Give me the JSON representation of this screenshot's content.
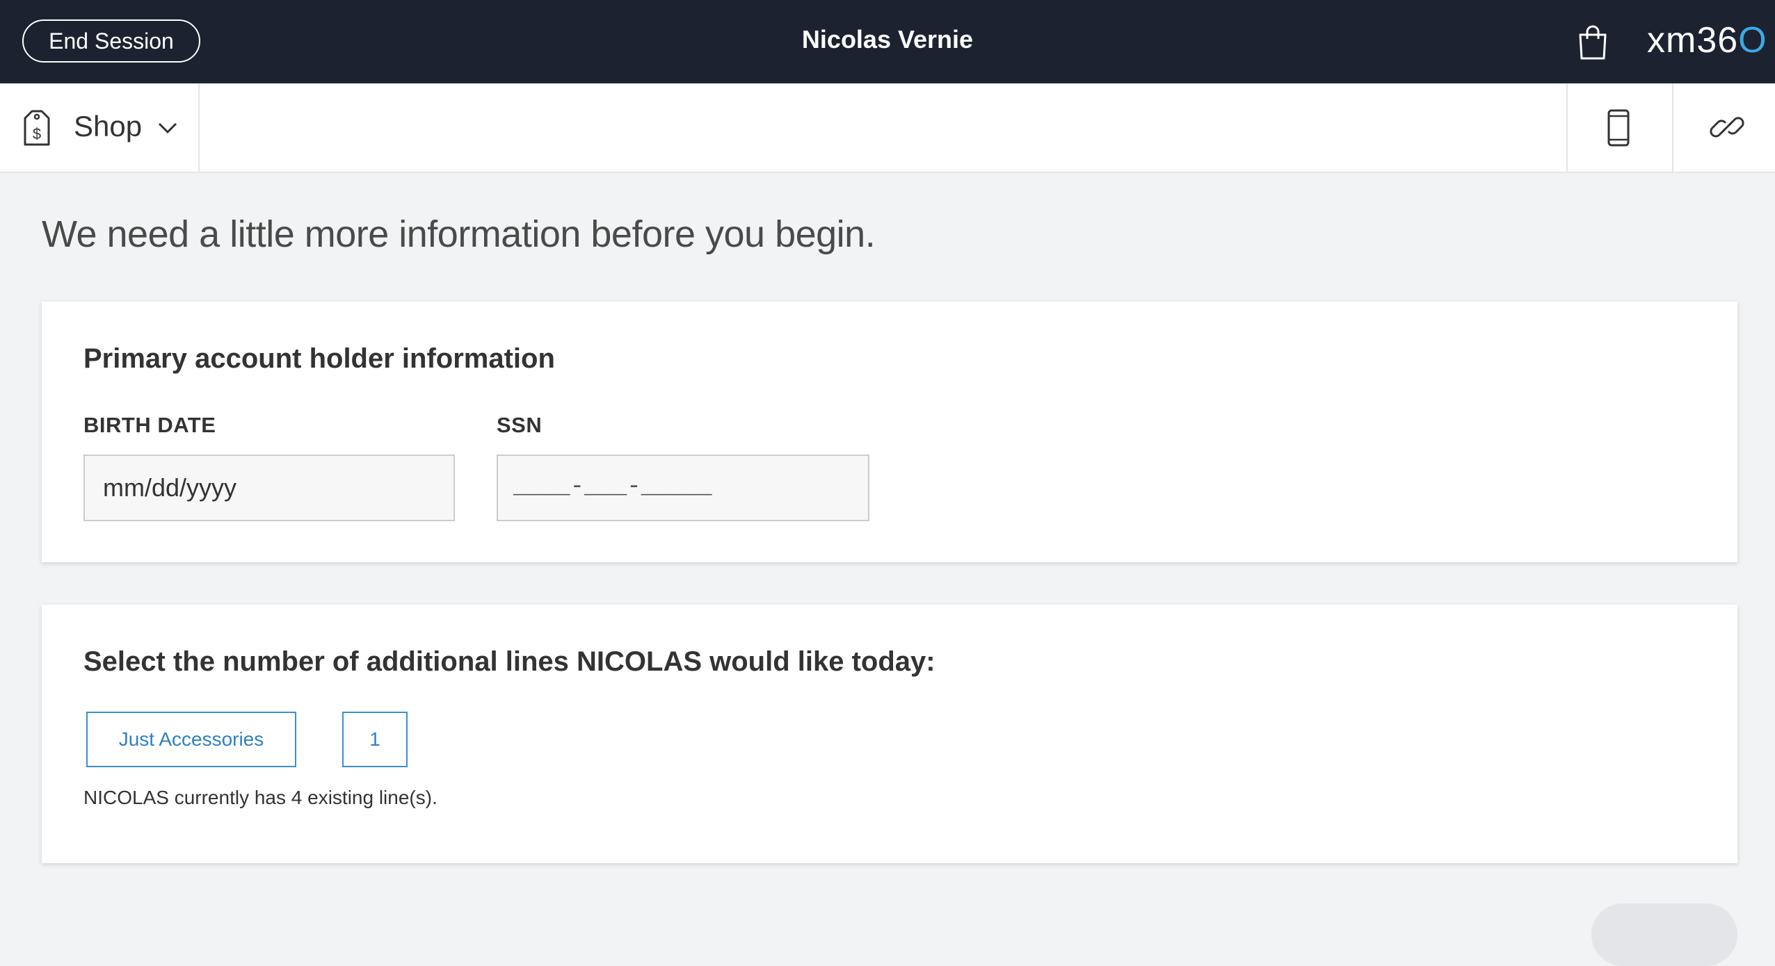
{
  "header": {
    "end_session_label": "End Session",
    "user_name": "Nicolas Vernie",
    "brand": "xm36",
    "brand_ring": "O"
  },
  "nav": {
    "shop_label": "Shop"
  },
  "main": {
    "intro": "We need a little more information before you begin.",
    "account_card": {
      "title": "Primary account holder information",
      "birth_date_label": "BIRTH DATE",
      "birth_date_placeholder": "mm/dd/yyyy",
      "birth_date_value": "",
      "ssn_label": "SSN",
      "ssn_mask": "____-___-_____",
      "ssn_value": ""
    },
    "lines_card": {
      "title": "Select the number of additional lines NICOLAS would like today:",
      "options": [
        "Just Accessories",
        "1"
      ],
      "note": "NICOLAS currently has 4 existing line(s)."
    }
  },
  "colors": {
    "topbar": "#1c2230",
    "accent": "#2f80c4",
    "brand_accent": "#3aa9e6",
    "page_bg": "#f2f3f4"
  },
  "icons": {
    "cart": "shopping-bag-icon",
    "shop": "price-tag-dollar-icon",
    "chevron": "chevron-down-icon",
    "device": "smartphone-icon",
    "link": "link-icon"
  }
}
